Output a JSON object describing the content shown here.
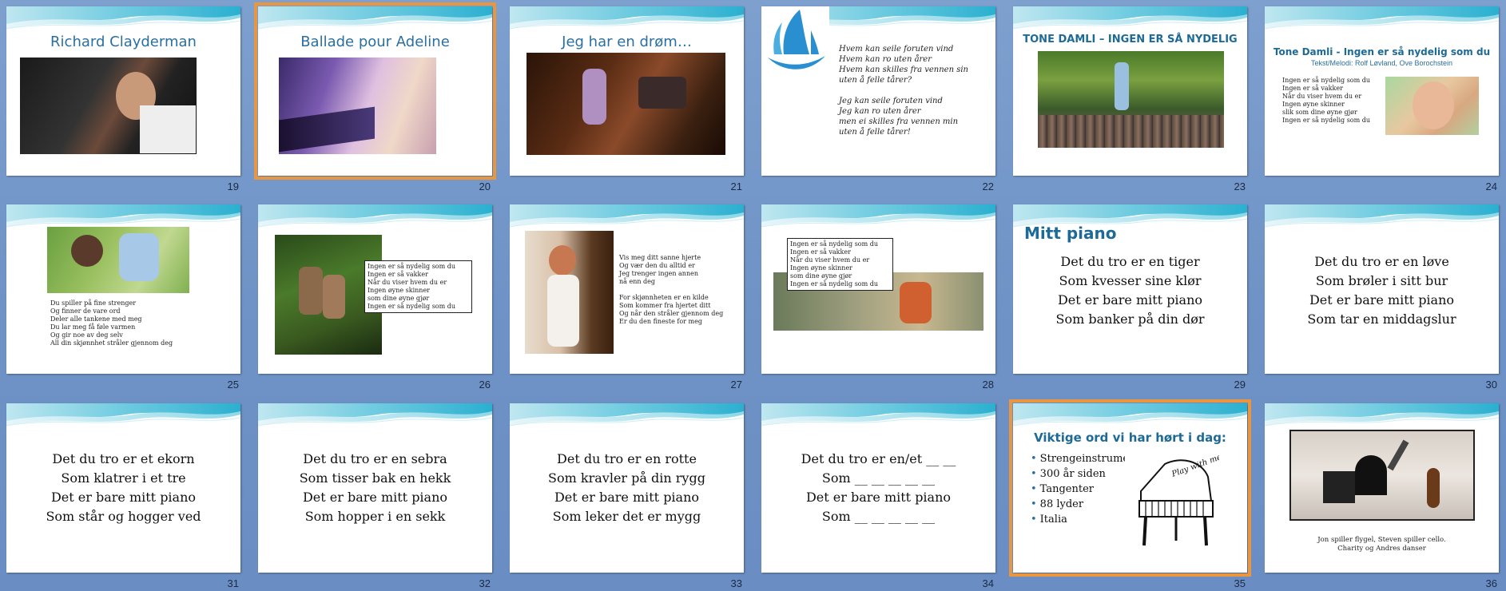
{
  "slides": [
    {
      "number": "19",
      "title": "Richard Clayderman"
    },
    {
      "number": "20",
      "title": "Ballade pour Adeline"
    },
    {
      "number": "21",
      "title": "Jeg har en drøm…"
    },
    {
      "number": "22",
      "lyrics": "Hvem kan seile foruten vind\nHvem kan ro uten årer\nHvem kan skilles fra vennen sin\nuten å felle tårer?\n\nJeg kan seile foruten vind\nJeg kan ro uten årer\nmen ei skilles fra vennen min\nuten å felle tårer!"
    },
    {
      "number": "23",
      "title": "TONE DAMLI – INGEN ER SÅ NYDELIG"
    },
    {
      "number": "24",
      "title": "Tone Damli - Ingen er så nydelig som du",
      "subtitle": "Tekst/Melodi: Rolf Løvland, Ove Borochstein",
      "lyrics": "Ingen er så nydelig som du\nIngen er så vakker\nNår du viser hvem du er\nIngen øyne skinner\nslik som dine øyne gjør\nIngen er så nydelig som du"
    },
    {
      "number": "25",
      "lyrics": "Du spiller på fine strenger\nOg finner de vare ord\nDeler alle tankene med meg\nDu lar meg få føle varmen\nOg gir noe av deg selv\nAll din skjønnhet stråler gjennom deg"
    },
    {
      "number": "26",
      "lyrics": "Ingen er så nydelig som du\nIngen er så vakker\nNår du viser hvem du er\nIngen øyne skinner\nsom dine øyne gjør\nIngen er så nydelig som du"
    },
    {
      "number": "27",
      "lyrics": "Vis meg ditt sanne hjerte\nOg vær den du alltid er\nJeg trenger ingen annen\n   nå enn deg\n\nFor skjønnheten er en kilde\nSom kommer fra hjertet ditt\nOg når den stråler gjennom deg\nEr du den fineste for meg"
    },
    {
      "number": "28",
      "lyrics": "Ingen er så nydelig som du\nIngen er så vakker\nNår du viser hvem du er\nIngen øyne skinner\nsom dine øyne gjør\nIngen er så nydelig som du"
    },
    {
      "number": "29",
      "title": "Mitt piano",
      "poem": [
        "Det du tro er en tiger",
        "Som kvesser sine klør",
        "Det er bare mitt piano",
        "Som banker på din dør"
      ]
    },
    {
      "number": "30",
      "poem": [
        "Det du tro er en løve",
        "Som brøler i sitt bur",
        "Det er bare mitt piano",
        "Som tar en middagslur"
      ]
    },
    {
      "number": "31",
      "poem": [
        "Det du tro er et ekorn",
        "Som klatrer i et tre",
        "Det er bare mitt piano",
        "Som står og hogger ved"
      ]
    },
    {
      "number": "32",
      "poem": [
        "Det du tro er en sebra",
        "Som tisser bak en hekk",
        "Det er bare mitt piano",
        "Som hopper i en sekk"
      ]
    },
    {
      "number": "33",
      "poem": [
        "Det du tro er en rotte",
        "Som kravler på din rygg",
        "Det er bare mitt piano",
        "Som leker det er mygg"
      ]
    },
    {
      "number": "34",
      "poem": [
        "Det du tro er en/et __ __",
        "Som __ __ __ __ __",
        "Det er bare mitt piano",
        "Som __ __ __ __ __"
      ]
    },
    {
      "number": "35",
      "title": "Viktige ord vi har hørt i dag:",
      "bullets": [
        "Strengeinstrument",
        "300 år siden",
        "Tangenter",
        "88 lyder",
        "Italia"
      ],
      "image_text": "Play with me"
    },
    {
      "number": "36",
      "caption": "Jon spiller flygel, Steven spiller cello.\nCharity og Andres danser"
    }
  ],
  "colors": {
    "accent": "#2a6fa0",
    "selection": "#e9963f",
    "background": "#7397c9"
  }
}
